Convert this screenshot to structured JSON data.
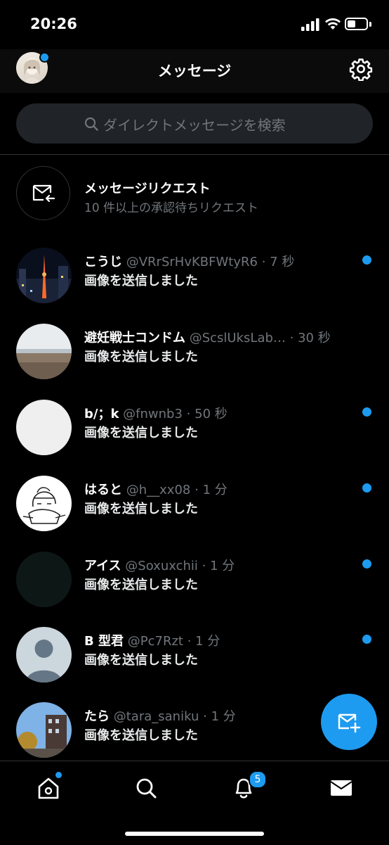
{
  "status_bar": {
    "time": "20:26",
    "battery_level": 0.45
  },
  "header": {
    "title": "メッセージ",
    "avatar_has_notification": true
  },
  "search": {
    "placeholder": "ダイレクトメッセージを検索"
  },
  "message_requests": {
    "title": "メッセージリクエスト",
    "subtitle": "10 件以上の承認待ちリクエスト"
  },
  "conversations": [
    {
      "name": "こうじ",
      "handle": "@VRrSrHvKBFWtyR6",
      "time": "7 秒",
      "preview": "画像を送信しました",
      "unread": true
    },
    {
      "name": "避妊戦士コンドム",
      "handle": "@ScslUksLab…",
      "time": "30 秒",
      "preview": "画像を送信しました",
      "unread": false
    },
    {
      "name": "b/；k",
      "handle": "@fnwnb3",
      "time": "50 秒",
      "preview": "画像を送信しました",
      "unread": true
    },
    {
      "name": "はると",
      "handle": "@h__xx08",
      "time": "1 分",
      "preview": "画像を送信しました",
      "unread": true
    },
    {
      "name": "アイス",
      "handle": "@Soxuxchii",
      "time": "1 分",
      "preview": "画像を送信しました",
      "unread": true
    },
    {
      "name": "B 型君",
      "handle": "@Pc7Rzt",
      "time": "1 分",
      "preview": "画像を送信しました",
      "unread": true
    },
    {
      "name": "たら",
      "handle": "@tara_saniku",
      "time": "1 分",
      "preview": "画像を送信しました",
      "unread": false
    }
  ],
  "bottom_nav": {
    "items": [
      "home-icon",
      "search-icon",
      "bell-icon",
      "mail-icon"
    ],
    "notification_count": "5"
  },
  "colors": {
    "accent": "#1d9bf0",
    "background": "#000000",
    "muted_text": "#71767b"
  }
}
